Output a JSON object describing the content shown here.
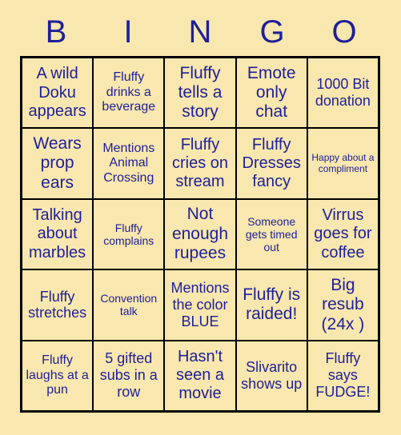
{
  "header": {
    "letters": [
      "B",
      "I",
      "N",
      "G",
      "O"
    ]
  },
  "colors": {
    "background": "#f8e7ae",
    "text": "#1f1f99",
    "border": "#000000"
  },
  "grid": {
    "rows": 5,
    "columns": 5,
    "cells": [
      {
        "text": "A wild Doku appears",
        "size": "fs-lg"
      },
      {
        "text": "Fluffy drinks a beverage",
        "size": "fs-sm"
      },
      {
        "text": "Fluffy tells a story",
        "size": "fs-xl"
      },
      {
        "text": "Emote only chat",
        "size": "fs-xl"
      },
      {
        "text": "1000 Bit donation",
        "size": "fs-md"
      },
      {
        "text": "Wears prop ears",
        "size": "fs-xl"
      },
      {
        "text": "Mentions Animal Crossing",
        "size": "fs-sm"
      },
      {
        "text": "Fluffy cries on stream",
        "size": "fs-lg"
      },
      {
        "text": "Fluffy Dresses fancy",
        "size": "fs-lg"
      },
      {
        "text": "Happy about a compliment",
        "size": "fs-xxs"
      },
      {
        "text": "Talking about marbles",
        "size": "fs-lg"
      },
      {
        "text": "Fluffy complains",
        "size": "fs-xs"
      },
      {
        "text": "Not enough rupees",
        "size": "fs-xl"
      },
      {
        "text": "Someone gets timed out",
        "size": "fs-xs"
      },
      {
        "text": "Virrus goes for coffee",
        "size": "fs-lg"
      },
      {
        "text": "Fluffy stretches",
        "size": "fs-md"
      },
      {
        "text": "Convention talk",
        "size": "fs-xs"
      },
      {
        "text": "Mentions the color BLUE",
        "size": "fs-md"
      },
      {
        "text": "Fluffy is raided!",
        "size": "fs-xl"
      },
      {
        "text": "Big resub (24x )",
        "size": "fs-xl"
      },
      {
        "text": "Fluffy laughs at a pun",
        "size": "fs-sm"
      },
      {
        "text": "5 gifted subs in a row",
        "size": "fs-md"
      },
      {
        "text": "Hasn't seen a movie",
        "size": "fs-lg"
      },
      {
        "text": "Slivarito shows up",
        "size": "fs-md"
      },
      {
        "text": "Fluffy says FUDGE!",
        "size": "fs-md"
      }
    ]
  }
}
